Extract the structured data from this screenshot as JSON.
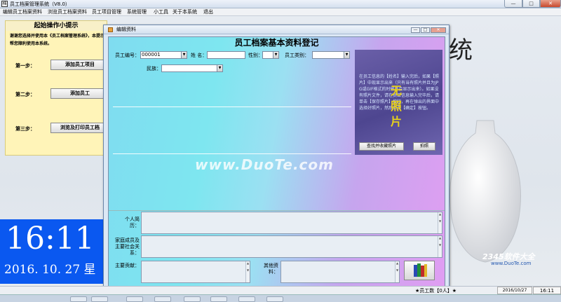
{
  "app": {
    "title": "员工档案管理系统（V8.0）",
    "min": "—",
    "max": "□",
    "close": "✕"
  },
  "menu": [
    "编辑员工档案资料",
    "浏览员工档案资料",
    "员工项目管理",
    "系统管理",
    "小工具",
    "关于本系统",
    "退出"
  ],
  "background": {
    "char": "统"
  },
  "tips": {
    "header": "起始操作小提示",
    "text": "谢谢您选择并使用本《员工档案管理系统》，本提示帮您顺利使用本系统。",
    "steps": [
      {
        "label": "第一步：",
        "button": "添加员工项目"
      },
      {
        "label": "第二步：",
        "button": "添加员工"
      },
      {
        "label": "第三步：",
        "button": "浏览及打印员工档"
      }
    ]
  },
  "clock": {
    "time": "16:11",
    "date": "2016. 10. 27 星"
  },
  "dialog": {
    "title": "编辑资料",
    "banner": "员工档案基本资料登记",
    "fields": {
      "emp_no_label": "员工编号：",
      "emp_no_value": "000001",
      "name_label": "姓  名：",
      "gender_label": "性别：",
      "type_label": "员工类别：",
      "ethnic_label": "民族："
    },
    "photo": {
      "text": "在员工信息的【姓名】输入完后，如果【照片】中现显示出来（只有当有照片并且为JPG或GIF格式的时候才会显示出来）。如果没有照片文件，请在员工信息输入完毕后，请单击【保存照片】按钮，再在弹出的界面中选择好照片，然后单击【确定】按钮。",
      "placeholder": "无照片",
      "browse_button": "查找并收藏照片",
      "capture_button": "拍照"
    },
    "resume_label": "个人简历：",
    "family_label": "家庭成员及主要社会关系：",
    "achievement_label": "主要贡献：",
    "other_label": "其他资料："
  },
  "watermark": {
    "main": "www.DuoTe.com",
    "brand": "2345软件大全",
    "brand_url": "www.DuoTe.com"
  },
  "status": {
    "count": "★员工数【0人】★",
    "date": "2016/10/27",
    "time": "16:11"
  }
}
